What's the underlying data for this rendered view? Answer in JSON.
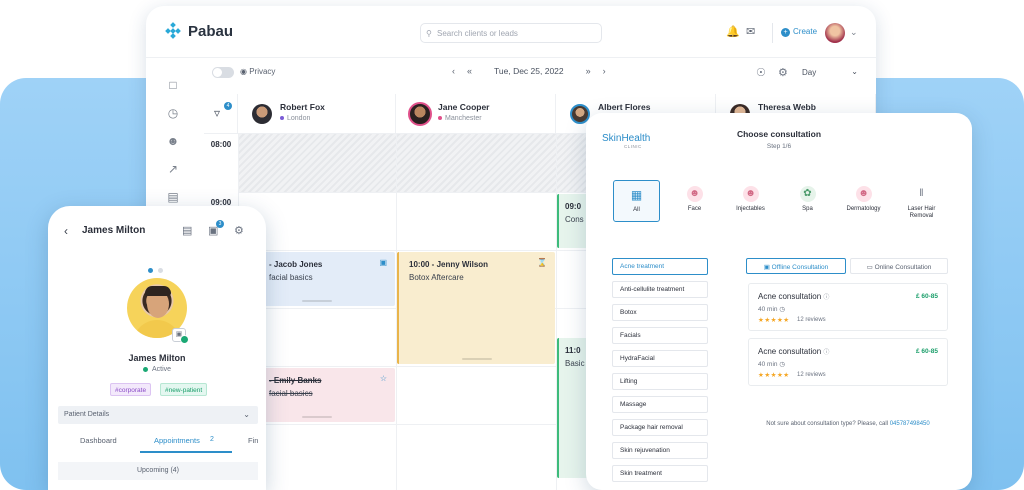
{
  "app": {
    "name": "Pabau"
  },
  "header": {
    "search_placeholder": "Search clients or leads",
    "create_label": "Create",
    "icons": [
      "bell-icon",
      "mail-icon",
      "chevron-down-icon"
    ]
  },
  "toolbar": {
    "privacy_label": "Privacy",
    "date": "Tue, Dec 25, 2022",
    "view": "Day"
  },
  "calendar": {
    "staff": [
      {
        "name": "Robert Fox",
        "location": "London",
        "dot_color": "#7b5cd6"
      },
      {
        "name": "Jane Cooper",
        "location": "Manchester",
        "dot_color": "#e0508a"
      },
      {
        "name": "Albert Flores",
        "location": "",
        "dot_color": "#2d8ec9"
      },
      {
        "name": "Theresa Webb",
        "location": "",
        "dot_color": "#2d8ec9"
      }
    ],
    "times": [
      "08:00",
      "09:00"
    ],
    "filter_badge": "4",
    "appointments": [
      {
        "time_name": "- Jacob Jones",
        "service": "facial basics",
        "color": "#e3ecf8"
      },
      {
        "time_name": "10:00 - Jenny Wilson",
        "service": "Botox Aftercare",
        "color": "#f9edcf"
      },
      {
        "time_name": "- Emily Banks",
        "service": "facial basics",
        "color": "#f9e6ea"
      },
      {
        "time_name": "09:0",
        "service": "Cons",
        "color": "#e6f4ec"
      },
      {
        "time_name": "11:0",
        "service": "Basic",
        "color": "#e6f4ec"
      }
    ]
  },
  "consultation": {
    "brand": "SkinHealth",
    "brand_sub": "CLINIC",
    "title": "Choose consultation",
    "step": "Step 1/6",
    "categories": [
      "All",
      "Face",
      "Injectables",
      "Spa",
      "Dermatology",
      "Laser Hair Removal"
    ],
    "treatments": [
      "Acne treatment",
      "Anti-cellulite treatment",
      "Botox",
      "Facials",
      "HydraFacial",
      "Lifting",
      "Massage",
      "Package hair removal",
      "Skin rejuvenation",
      "Skin treatment"
    ],
    "tabs": [
      "Offline Consultation",
      "Online Consultation"
    ],
    "offers": [
      {
        "name": "Acne consultation",
        "price": "£ 60-85",
        "duration": "40 min",
        "rating_stars": 5,
        "reviews": "12 reviews"
      },
      {
        "name": "Acne consultation",
        "price": "£ 60-85",
        "duration": "40 min",
        "rating_stars": 5,
        "reviews": "12 reviews"
      }
    ],
    "footer_text": "Not sure about consultation type? Please, call ",
    "footer_phone": "045787498450"
  },
  "mobile": {
    "title": "James Milton",
    "notif_badge": "3",
    "patient_name": "James Milton",
    "status": "Active",
    "tags": [
      "#corporate",
      "#new-patient"
    ],
    "section": "Patient Details",
    "tabs": [
      "Dashboard",
      "Appointments",
      "Fin"
    ],
    "appointments_count": "2",
    "upcoming": "Upcoming (4)"
  }
}
